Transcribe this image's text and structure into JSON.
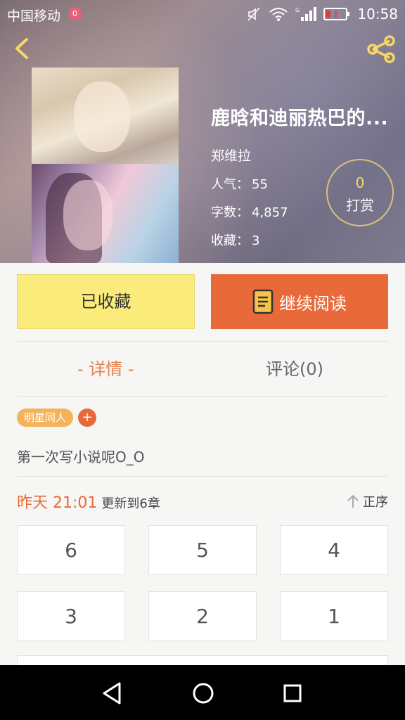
{
  "status_bar": {
    "carrier": "中国移动",
    "notification_badge": "0",
    "time": "10:58"
  },
  "book": {
    "title": "鹿晗和迪丽热巴的...",
    "author": "郑维拉",
    "author_prefix": "",
    "popularity_label": "人气：",
    "popularity_value": "55",
    "word_count_label": "字数：",
    "word_count_value": "4,857",
    "favorites_label": "收藏：",
    "favorites_value": "3"
  },
  "reward": {
    "count": "0",
    "label": "打赏"
  },
  "actions": {
    "favorited_label": "已收藏",
    "continue_label": "继续阅读"
  },
  "tabs": [
    {
      "label": "- 详情 -",
      "active": true
    },
    {
      "label": "评论(0)",
      "active": false
    }
  ],
  "tags": [
    {
      "label": "明星同人"
    },
    {
      "label": "+"
    }
  ],
  "summary": "第一次写小说呢O_O",
  "update": {
    "time": "昨天 21:01",
    "text": "更新到6章",
    "order_label": "正序"
  },
  "chapters": [
    "6",
    "5",
    "4",
    "3",
    "2",
    "1"
  ],
  "colors": {
    "accent": "#e86a3a",
    "favorite_bg": "#fbeb7a",
    "tag_bg": "#f4b35a",
    "reward_count": "#f4d766"
  }
}
